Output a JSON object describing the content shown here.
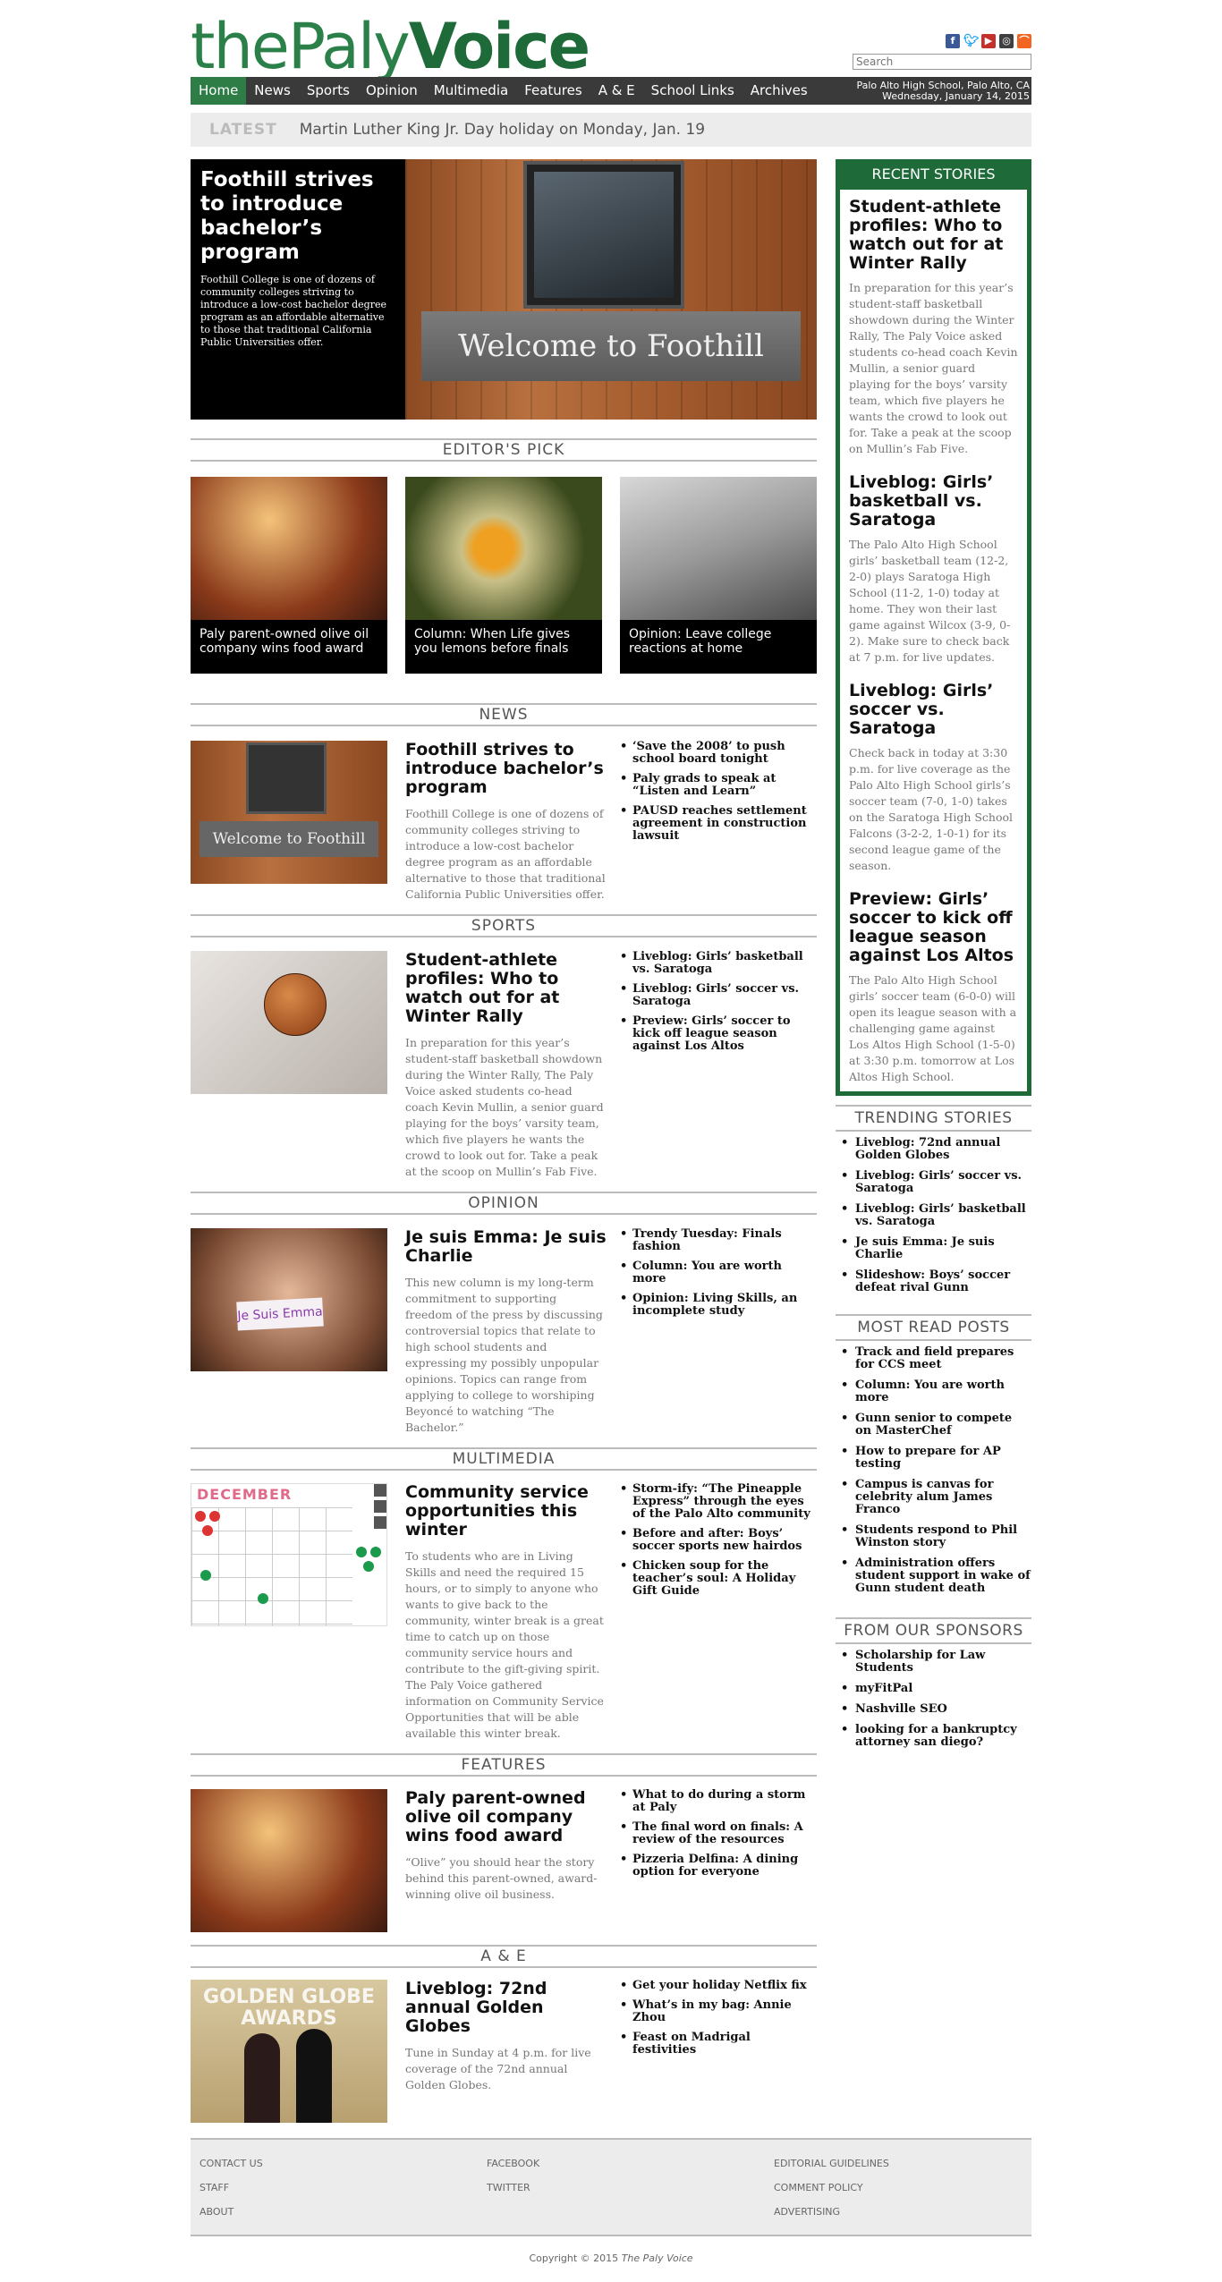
{
  "site": {
    "logo_thin": "thePaly",
    "logo_bold": "Voice"
  },
  "search": {
    "placeholder": "Search"
  },
  "nav": {
    "items": [
      "Home",
      "News",
      "Sports",
      "Opinion",
      "Multimedia",
      "Features",
      "A & E",
      "School Links",
      "Archives"
    ],
    "location": "Palo Alto High School, Palo Alto, CA",
    "date": "Wednesday, January 14, 2015"
  },
  "latest": {
    "tag": "LATEST",
    "text": "Martin Luther King Jr. Day holiday on Monday, Jan. 19"
  },
  "hero": {
    "title": "Foothill strives to introduce bachelor’s program",
    "desc": "Foothill College is one of dozens of community colleges striving to introduce a low-cost bachelor degree program as an affordable alternative to those that traditional California Public Universities offer.",
    "banner": "Welcome to Foothill"
  },
  "editors_pick": {
    "heading": "EDITOR'S PICK",
    "items": [
      "Paly parent-owned olive oil company wins food award",
      "Column: When Life gives you lemons before finals",
      "Opinion: Leave college reactions at home"
    ]
  },
  "sections": {
    "news": {
      "heading": "NEWS",
      "title": "Foothill strives to introduce bachelor’s program",
      "desc": "Foothill College is one of dozens of community colleges striving to introduce a low-cost bachelor degree program as an affordable alternative to those that traditional California Public Universities offer.",
      "links": [
        "‘Save the 2008’ to push school board tonight",
        "Paly grads to speak at “Listen and Learn”",
        "PAUSD reaches settlement agreement in construction lawsuit"
      ]
    },
    "sports": {
      "heading": "SPORTS",
      "title": "Student-athlete profiles: Who to watch out for at Winter Rally",
      "desc": "In preparation for this year’s student-staff basketball showdown during the Winter Rally, The Paly Voice asked students co-head coach Kevin Mullin, a senior guard playing for the boys’ varsity team, which five players he wants the crowd to look out for. Take a peak at the scoop on Mullin’s Fab Five.",
      "links": [
        "Liveblog: Girls’ basketball vs. Saratoga",
        "Liveblog: Girls’ soccer vs. Saratoga",
        "Preview: Girls’ soccer to kick off league season against Los Altos"
      ]
    },
    "opinion": {
      "heading": "OPINION",
      "title": "Je suis Emma: Je suis Charlie",
      "desc": "This new column is my long-term commitment to supporting freedom of the press by discussing controversial topics that relate to high school students and expressing my possibly unpopular opinions. Topics can range from applying to college to worshiping Beyoncé to watching “The Bachelor.”",
      "sign": "Je Suis Emma",
      "links": [
        "Trendy Tuesday: Finals fashion",
        "Column: You are worth more",
        "Opinion: Living Skills, an incomplete study"
      ]
    },
    "multimedia": {
      "heading": "MULTIMEDIA",
      "title": "Community service opportunities this winter",
      "desc": "To students who are in Living Skills and need the required 15 hours, or to simply to anyone who wants to give back to the community, winter break is a great time to catch up on those community service hours and contribute to the gift-giving spirit. The Paly Voice gathered information on Community Service Opportunities that will be able available this winter break.",
      "calendar_title": "DECEMBER",
      "links": [
        "Storm-ify: “The Pineapple Express” through the eyes of the Palo Alto community",
        "Before and after: Boys’ soccer sports new hairdos",
        "Chicken soup for the teacher’s soul: A Holiday Gift Guide"
      ]
    },
    "features": {
      "heading": "FEATURES",
      "title": "Paly parent-owned olive oil company wins food award",
      "desc": "“Olive” you should hear the story behind this parent-owned, award-winning olive oil business.",
      "links": [
        "What to do during a storm at Paly",
        "The final word on finals: A review of the resources",
        "Pizzeria Delfina: A dining option for everyone"
      ]
    },
    "ae": {
      "heading": "A & E",
      "title": "Liveblog: 72nd annual Golden Globes",
      "desc": "Tune in Sunday at 4 p.m. for live coverage of the 72nd annual Golden Globes.",
      "backdrop": "GOLDEN GLOBE AWARDS",
      "links": [
        "Get your holiday Netflix fix",
        "What’s in my bag: Annie Zhou",
        "Feast on Madrigal festivities"
      ]
    }
  },
  "recent": {
    "heading": "RECENT STORIES",
    "stories": [
      {
        "title": "Student-athlete profiles: Who to watch out for at Winter Rally",
        "desc": "In preparation for this year’s student-staff basketball showdown during the Winter Rally, The Paly Voice asked students co-head coach Kevin Mullin, a senior guard playing for the boys’ varsity team, which five players he wants the crowd to look out for. Take a peak at the scoop on Mullin’s Fab Five."
      },
      {
        "title": "Liveblog: Girls’ basketball vs. Saratoga",
        "desc": "The Palo Alto High School girls’ basketball team (12-2, 2-0) plays Saratoga High School (11-2, 1-0) today at home. They won their last game against Wilcox (3-9, 0-2). Make sure to check back at 7 p.m. for live updates."
      },
      {
        "title": "Liveblog: Girls’ soccer vs. Saratoga",
        "desc": "Check back in today at 3:30 p.m. for live coverage as the Palo Alto High School girls’s soccer team (7-0, 1-0) takes on the Saratoga High School Falcons (3-2-2, 1-0-1) for its second league game of the season."
      },
      {
        "title": "Preview: Girls’ soccer to kick off league season against Los Altos",
        "desc": "The Palo Alto High School girls’ soccer team (6-0-0) will open its league season with a challenging game against Los Altos High School (1-5-0) at 3:30 p.m. tomorrow at Los Altos High School."
      }
    ]
  },
  "trending": {
    "heading": "TRENDING STORIES",
    "items": [
      "Liveblog: 72nd annual Golden Globes",
      "Liveblog: Girls’ soccer vs. Saratoga",
      "Liveblog: Girls’ basketball vs. Saratoga",
      "Je suis Emma: Je suis Charlie",
      "Slideshow: Boys’ soccer defeat rival Gunn"
    ]
  },
  "most_read": {
    "heading": "MOST READ POSTS",
    "items": [
      "Track and field prepares for CCS meet",
      "Column: You are worth more",
      "Gunn senior to compete on MasterChef",
      "How to prepare for AP testing",
      "Campus is canvas for celebrity alum James Franco",
      "Students respond to Phil Winston story",
      "Administration offers student support in wake of Gunn student death"
    ]
  },
  "sponsors": {
    "heading": "FROM OUR SPONSORS",
    "items": [
      "Scholarship for Law Students",
      "myFitPal",
      "Nashville SEO",
      "looking for a bankruptcy attorney san diego?"
    ]
  },
  "footer": {
    "col1": [
      "CONTACT US",
      "STAFF",
      "ABOUT"
    ],
    "col2": [
      "FACEBOOK",
      "TWITTER"
    ],
    "col3": [
      "EDITORIAL GUIDELINES",
      "COMMENT POLICY",
      "ADVERTISING"
    ],
    "copyright_prefix": "Copyright © 2015",
    "copyright_name": "The Paly Voice"
  },
  "colors": {
    "brand_green": "#1e6b39",
    "nav_bg": "#3a3a3a",
    "active_nav": "#2e7d46"
  }
}
